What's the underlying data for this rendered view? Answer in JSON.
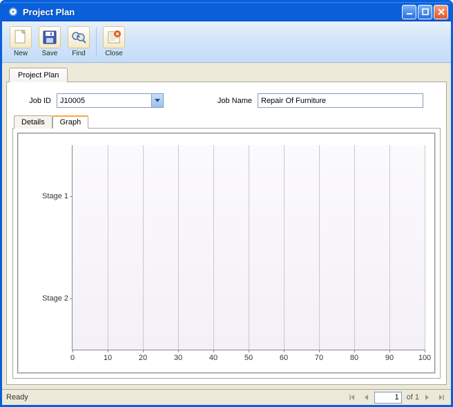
{
  "window": {
    "title": "Project Plan"
  },
  "toolbar": {
    "new_label": "New",
    "save_label": "Save",
    "find_label": "Find",
    "close_label": "Close"
  },
  "outer_tab": {
    "label": "Project Plan"
  },
  "form": {
    "job_id_label": "Job ID",
    "job_id_value": "J10005",
    "job_name_label": "Job Name",
    "job_name_value": "Repair Of Furniture"
  },
  "inner_tabs": {
    "details": "Details",
    "graph": "Graph",
    "active": "graph"
  },
  "chart_data": {
    "type": "bar",
    "categories": [
      "Stage 1",
      "Stage 2"
    ],
    "values": [
      0,
      0
    ],
    "xlim": [
      0,
      100
    ],
    "xticks": [
      0,
      10,
      20,
      30,
      40,
      50,
      60,
      70,
      80,
      90,
      100
    ],
    "title": "",
    "xlabel": "",
    "ylabel": ""
  },
  "status": {
    "ready": "Ready"
  },
  "pager": {
    "current": "1",
    "of_text": " of ",
    "total": "1"
  }
}
